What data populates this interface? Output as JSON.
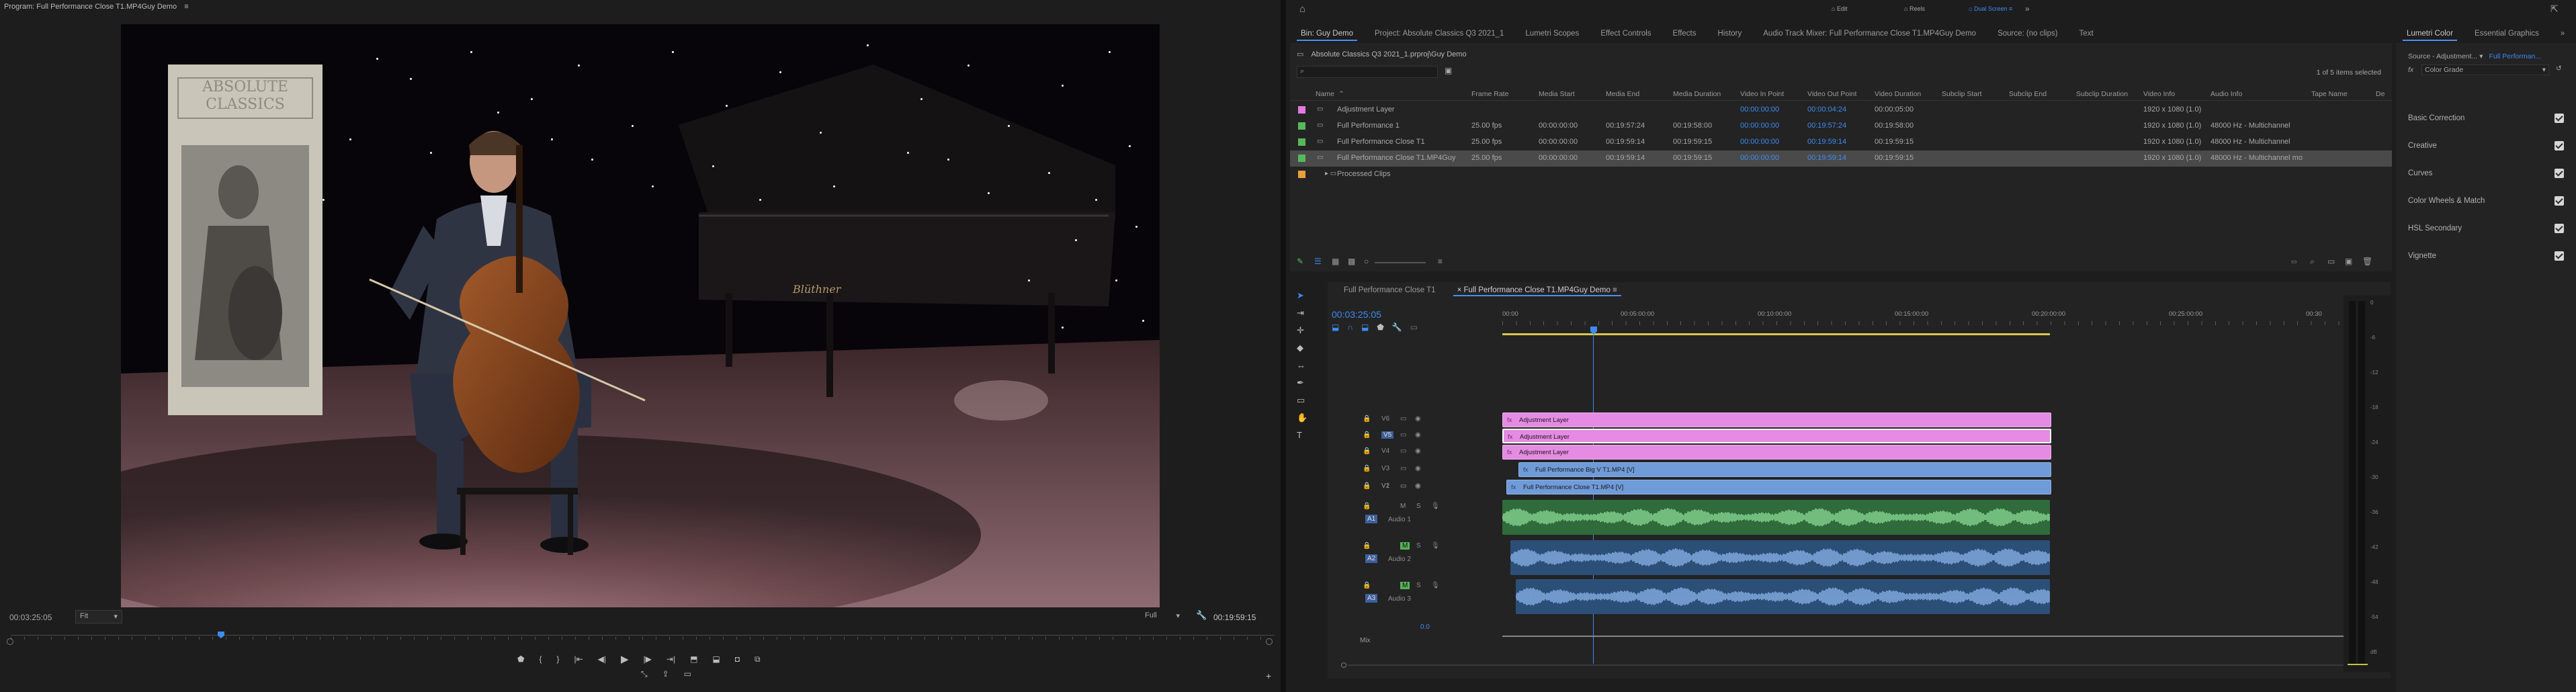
{
  "program": {
    "title": "Program: Full Performance Close T1.MP4Guy Demo",
    "timecode": "00:03:25:05",
    "fit": "Fit",
    "quality": "Full",
    "duration": "00:19:59:15"
  },
  "video_content": {
    "banner_line1": "ABSOLUTE",
    "banner_line2": "CLASSICS",
    "piano_brand": "Blüthner"
  },
  "workspaces": {
    "edit": "Edit",
    "reels": "Reels",
    "dual_screen": "Dual Screen"
  },
  "project_panel": {
    "tabs": [
      "Bin: Guy Demo",
      "Project: Absolute Classics Q3 2021_1",
      "Lumetri Scopes",
      "Effect Controls",
      "Effects",
      "History",
      "Audio Track Mixer: Full Performance Close T1.MP4Guy Demo",
      "Source: (no clips)",
      "Text"
    ],
    "path": "Absolute Classics Q3 2021_1.prproj\\Guy Demo",
    "selection": "1 of 5 items selected",
    "columns": [
      "Name",
      "Frame Rate",
      "Media Start",
      "Media End",
      "Media Duration",
      "Video In Point",
      "Video Out Point",
      "Video Duration",
      "Subclip Start",
      "Subclip End",
      "Subclip Duration",
      "Video Info",
      "Audio Info",
      "Tape Name",
      "De"
    ],
    "rows": [
      {
        "name": "Adjustment Layer",
        "color": "#e37be0",
        "frame_rate": "",
        "media_start": "",
        "media_end": "",
        "media_duration": "",
        "in": "00:00:00:00",
        "out": "00:00:04:24",
        "vdur": "00:00:05:00",
        "video_info": "1920 x 1080 (1.0)",
        "audio_info": ""
      },
      {
        "name": "Full Performance 1",
        "color": "#56b85a",
        "frame_rate": "25.00 fps",
        "media_start": "00:00:00:00",
        "media_end": "00:19:57:24",
        "media_duration": "00:19:58:00",
        "in": "00:00:00:00",
        "out": "00:19:57:24",
        "vdur": "00:19:58:00",
        "video_info": "1920 x 1080 (1.0)",
        "audio_info": "48000 Hz - Multichannel"
      },
      {
        "name": "Full Performance Close T1",
        "color": "#56b85a",
        "frame_rate": "25.00 fps",
        "media_start": "00:00:00:00",
        "media_end": "00:19:59:14",
        "media_duration": "00:19:59:15",
        "in": "00:00:00:00",
        "out": "00:19:59:14",
        "vdur": "00:19:59:15",
        "video_info": "1920 x 1080 (1.0)",
        "audio_info": "48000 Hz - Multichannel"
      },
      {
        "name": "Full Performance Close T1.MP4Guy",
        "color": "#56b85a",
        "frame_rate": "25.00 fps",
        "media_start": "00:00:00:00",
        "media_end": "00:19:59:14",
        "media_duration": "00:19:59:15",
        "in": "00:00:00:00",
        "out": "00:19:59:14",
        "vdur": "00:19:59:15",
        "video_info": "1920 x 1080 (1.0)",
        "audio_info": "48000 Hz - Multichannel mo"
      },
      {
        "name": "Processed Clips",
        "color": "#e8a13a",
        "frame_rate": "",
        "media_start": "",
        "media_end": "",
        "media_duration": "",
        "in": "",
        "out": "",
        "vdur": "",
        "video_info": "",
        "audio_info": ""
      }
    ]
  },
  "lumetri": {
    "tabs": [
      "Lumetri Color",
      "Essential Graphics"
    ],
    "source_label": "Source - Adjustment...",
    "source_target": "Full Performan...",
    "fx": "fx",
    "preset": "Color Grade",
    "sections": [
      "Basic Correction",
      "Creative",
      "Curves",
      "Color Wheels & Match",
      "HSL Secondary",
      "Vignette"
    ]
  },
  "timeline": {
    "tabs": [
      "Full Performance Close T1",
      "Full Performance Close T1.MP4Guy Demo"
    ],
    "timecode": "00:03:25:05",
    "ruler": [
      "00:00",
      "00:05:00:00",
      "00:10:00:00",
      "00:15:00:00",
      "00:20:00:00",
      "00:25:00:00",
      "00:30"
    ],
    "video_tracks": [
      "V6",
      "V5",
      "V4",
      "V3",
      "V2",
      "V1"
    ],
    "audio_tracks": [
      {
        "id": "A1",
        "name": "Audio 1"
      },
      {
        "id": "A2",
        "name": "Audio 2"
      },
      {
        "id": "A3",
        "name": "Audio 3"
      }
    ],
    "clips": {
      "adj1": "Adjustment Layer",
      "adj2": "Adjustment Layer",
      "adj3": "Adjustment Layer",
      "v2": "Full Performance Big V T1.MP4 [V]",
      "v1": "Full Performance Close T1.MP4 [V]"
    },
    "mix_label": "Mix",
    "mix_value": "0.0",
    "track_letters": {
      "m": "M",
      "s": "S"
    }
  },
  "meter_scale": [
    "0",
    "-6",
    "-12",
    "-18",
    "-24",
    "-30",
    "-36",
    "-42",
    "-48",
    "-54",
    "dB"
  ]
}
